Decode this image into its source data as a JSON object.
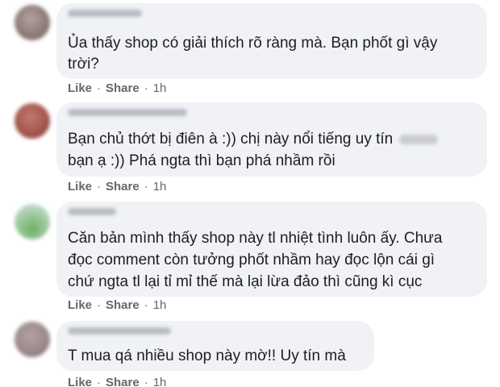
{
  "comments": [
    {
      "author": "Thu Ngọc Lương",
      "lines": [
        "Ủa thấy shop có giải thích rõ ràng mà. Bạn phốt gì vậy",
        "trời?"
      ],
      "actions": {
        "like": "Like",
        "share": "Share",
        "separator": "·",
        "time": "1h"
      },
      "avatar_color": "#8e7b78"
    },
    {
      "author": "Nguyễn Minh Phúc",
      "lines": [
        "Bạn chủ thớt bị điên à :)) chị này nổi tiếng uy tín",
        "bạn ạ :)) Phá ngta thì bạn phá nhầm rồi"
      ],
      "actions": {
        "like": "Like",
        "share": "Share",
        "separator": "·",
        "time": "1h"
      },
      "avatar_color": "#a4564f"
    },
    {
      "author": "Thùy Linh",
      "lines": [
        "Căn bản mình thấy shop này tl nhiệt tình luôn ấy. Chưa",
        "đọc comment còn tưởng phốt nhầm hay đọc lộn cái gì",
        "chứ ngta tl lại tỉ mỉ thế mà lại lừa đảo thì cũng kì cục"
      ],
      "actions": {
        "like": "Like",
        "share": "Share",
        "separator": "·",
        "time": "1h"
      },
      "avatar_color": "#7fb87a"
    },
    {
      "author": "Thủy Hoàng Vũ",
      "lines": [
        "T mua qá nhiều shop này mờ!! Uy tín mà"
      ],
      "actions": {
        "like": "Like",
        "share": "Share",
        "separator": "·",
        "time": "1h"
      },
      "avatar_color": "#9a8a8c"
    }
  ]
}
